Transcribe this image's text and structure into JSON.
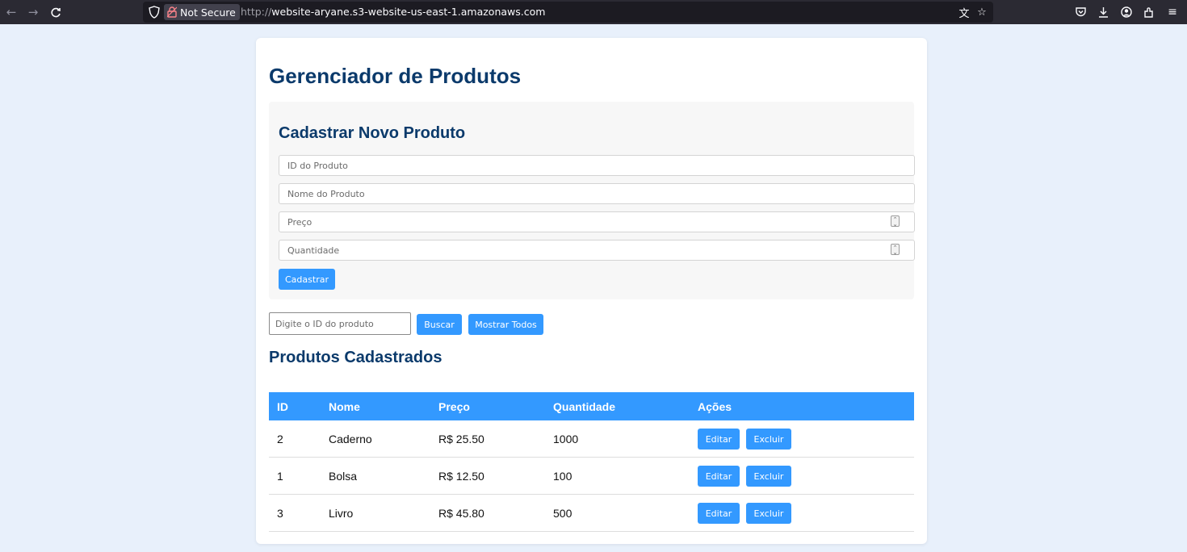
{
  "browser": {
    "security_label": "Not Secure",
    "url_protocol": "http://",
    "url_host": "website-aryane.s3-website-us-east-1.amazonaws.com"
  },
  "page": {
    "title": "Gerenciador de Produtos"
  },
  "form": {
    "title": "Cadastrar Novo Produto",
    "id_placeholder": "ID do Produto",
    "nome_placeholder": "Nome do Produto",
    "preco_placeholder": "Preço",
    "quantidade_placeholder": "Quantidade",
    "submit_label": "Cadastrar"
  },
  "search": {
    "placeholder": "Digite o ID do produto",
    "buscar_label": "Buscar",
    "mostrar_todos_label": "Mostrar Todos"
  },
  "list": {
    "title": "Produtos Cadastrados",
    "columns": [
      "ID",
      "Nome",
      "Preço",
      "Quantidade",
      "Ações"
    ],
    "rows": [
      {
        "id": "2",
        "nome": "Caderno",
        "preco": "R$ 25.50",
        "quantidade": "1000",
        "editar": "Editar",
        "excluir": "Excluir"
      },
      {
        "id": "1",
        "nome": "Bolsa",
        "preco": "R$ 12.50",
        "quantidade": "100",
        "editar": "Editar",
        "excluir": "Excluir"
      },
      {
        "id": "3",
        "nome": "Livro",
        "preco": "R$ 45.80",
        "quantidade": "500",
        "editar": "Editar",
        "excluir": "Excluir"
      }
    ]
  },
  "colors": {
    "accent": "#3399ff",
    "heading": "#0b3a6b",
    "background": "#e8f0fb"
  }
}
